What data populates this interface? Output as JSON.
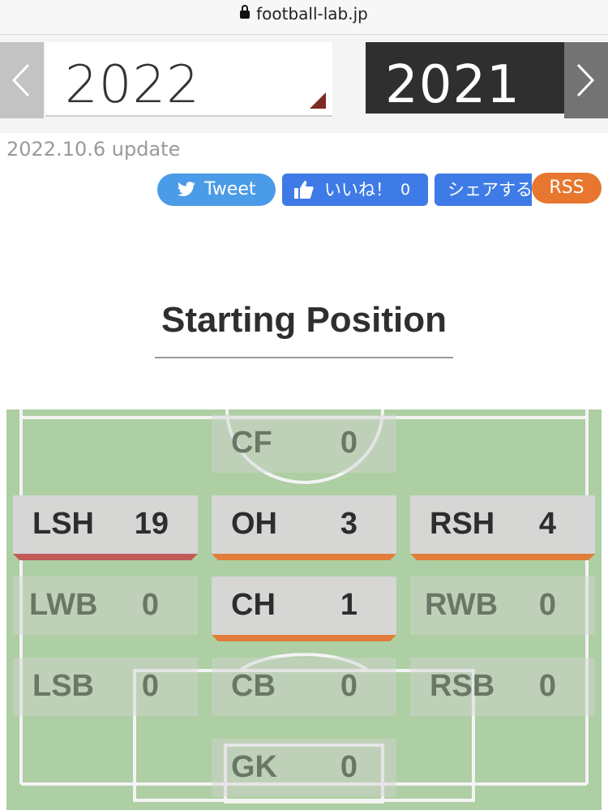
{
  "browser": {
    "url": "football-lab.jp"
  },
  "years": {
    "current": "2022",
    "previous": "2021"
  },
  "update_text": "2022.10.6 update",
  "social": {
    "tweet": "Tweet",
    "like": "いいね！",
    "like_count": "0",
    "share": "シェアする",
    "rss": "RSS"
  },
  "section_title": "Starting Position",
  "positions": [
    {
      "label": "CF",
      "value": "0"
    },
    {
      "label": "LSH",
      "value": "19"
    },
    {
      "label": "OH",
      "value": "3"
    },
    {
      "label": "RSH",
      "value": "4"
    },
    {
      "label": "LWB",
      "value": "0"
    },
    {
      "label": "CH",
      "value": "1"
    },
    {
      "label": "RWB",
      "value": "0"
    },
    {
      "label": "LSB",
      "value": "0"
    },
    {
      "label": "CB",
      "value": "0"
    },
    {
      "label": "RSB",
      "value": "0"
    },
    {
      "label": "GK",
      "value": "0"
    }
  ],
  "colors": {
    "highlight_orange": "#e07d3a",
    "highlight_red": "#c25b58",
    "pitch": "#adcfa3"
  }
}
